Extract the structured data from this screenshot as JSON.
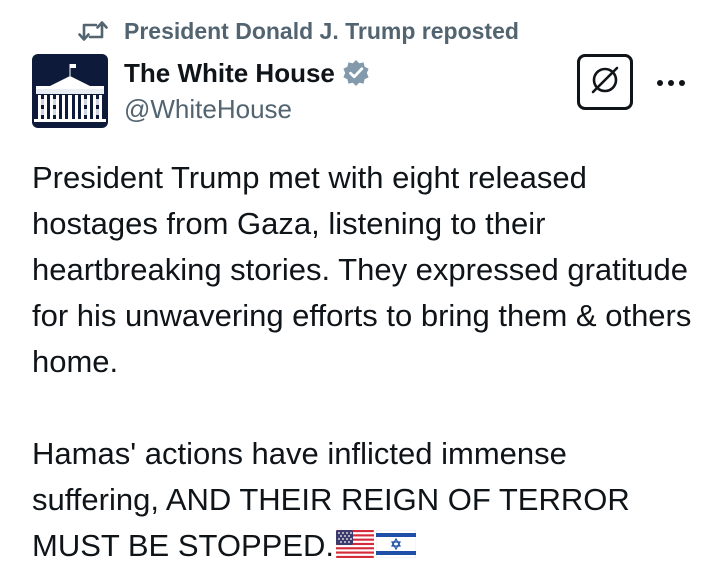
{
  "repost": {
    "icon": "repost-icon",
    "text": "President Donald J. Trump reposted"
  },
  "author": {
    "avatar_icon": "white-house-logo",
    "display_name": "The White House",
    "verified_icon": "verified-badge-icon",
    "handle": "@WhiteHouse"
  },
  "actions": {
    "grok_icon": "grok-icon",
    "more_icon": "more-icon"
  },
  "tweet": {
    "paragraph_1": "President Trump met with eight released hostages from Gaza, listening to their heartbreaking stories. They expressed gratitude for his unwavering efforts to bring them & others home.",
    "paragraph_2": "Hamas' actions have inflicted immense suffering, AND THEIR REIGN OF TERROR MUST BE STOPPED.",
    "emojis": [
      "us-flag-emoji",
      "israel-flag-emoji"
    ]
  },
  "colors": {
    "text": "#0f1419",
    "secondary": "#536471",
    "verified_badge": "#829aab",
    "avatar_bg": "#0e1a3a"
  }
}
